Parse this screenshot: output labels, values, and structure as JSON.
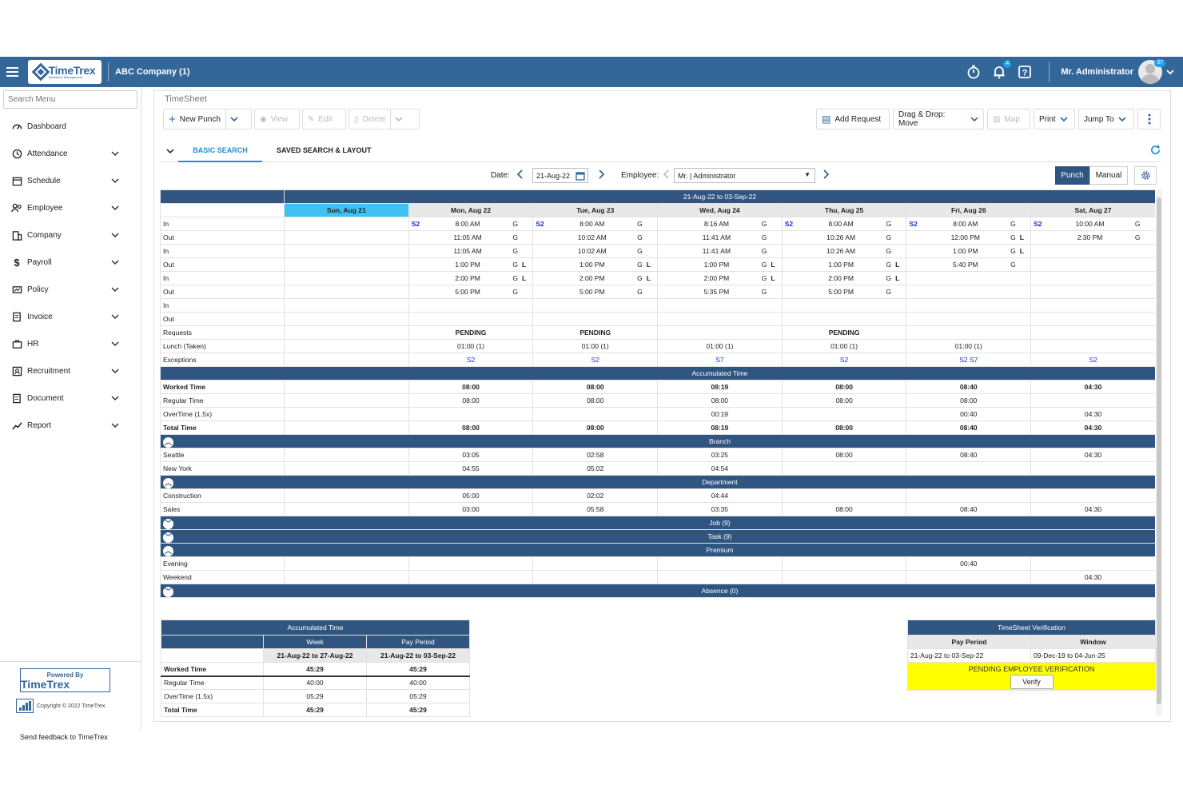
{
  "header": {
    "company": "ABC Company (1)",
    "user": "Mr. Administrator",
    "notifications_badge": "4",
    "avatar_badge": "37",
    "logo_text": "TimeTrex"
  },
  "sidebar": {
    "search_placeholder": "Search Menu",
    "items": [
      {
        "label": "Dashboard",
        "icon": "dashboard-icon"
      },
      {
        "label": "Attendance",
        "icon": "clock-icon"
      },
      {
        "label": "Schedule",
        "icon": "calendar-icon"
      },
      {
        "label": "Employee",
        "icon": "people-icon"
      },
      {
        "label": "Company",
        "icon": "building-icon"
      },
      {
        "label": "Payroll",
        "icon": "dollar-icon"
      },
      {
        "label": "Policy",
        "icon": "policy-icon"
      },
      {
        "label": "Invoice",
        "icon": "invoice-icon"
      },
      {
        "label": "HR",
        "icon": "briefcase-icon"
      },
      {
        "label": "Recruitment",
        "icon": "recruitment-icon"
      },
      {
        "label": "Document",
        "icon": "document-icon"
      },
      {
        "label": "Report",
        "icon": "chart-icon"
      }
    ],
    "powered_by": "Powered By",
    "powered_name": "TimeTrex",
    "copyright": "Copyright © 2022 TimeTrex.",
    "feedback": "Send feedback to TimeTrex"
  },
  "toolbar": {
    "title": "TimeSheet",
    "new_punch": "New Punch",
    "view": "View",
    "edit": "Edit",
    "delete": "Delete",
    "add_request": "Add Request",
    "drag_drop": "Drag & Drop: Move",
    "map": "Map",
    "print": "Print",
    "jump_to": "Jump To"
  },
  "tabs": {
    "basic": "BASIC SEARCH",
    "saved": "SAVED SEARCH & LAYOUT"
  },
  "filter": {
    "date_label": "Date:",
    "date_value": "21-Aug-22",
    "employee_label": "Employee:",
    "employee_value": "Mr. | Administrator",
    "punch": "Punch",
    "manual": "Manual"
  },
  "grid": {
    "range": "21-Aug-22 to 03-Sep-22",
    "days": [
      "Sun, Aug 21",
      "Mon, Aug 22",
      "Tue, Aug 23",
      "Wed, Aug 24",
      "Thu, Aug 25",
      "Fri, Aug 26",
      "Sat, Aug 27"
    ],
    "punch_rows": [
      {
        "label": "In",
        "cells": [
          null,
          {
            "s": "S2",
            "t": "8:00 AM",
            "g": "G",
            "l": ""
          },
          {
            "s": "S2",
            "t": "8:00 AM",
            "g": "G",
            "l": ""
          },
          {
            "s": "",
            "t": "8:16 AM",
            "g": "G",
            "l": ""
          },
          {
            "s": "S2",
            "t": "8:00 AM",
            "g": "G",
            "l": ""
          },
          {
            "s": "S2",
            "t": "8:00 AM",
            "g": "G",
            "l": ""
          },
          {
            "s": "S2",
            "t": "10:00 AM",
            "g": "G",
            "l": ""
          }
        ]
      },
      {
        "label": "Out",
        "cells": [
          null,
          {
            "s": "",
            "t": "11:05 AM",
            "g": "G",
            "l": ""
          },
          {
            "s": "",
            "t": "10:02 AM",
            "g": "G",
            "l": ""
          },
          {
            "s": "",
            "t": "11:41 AM",
            "g": "G",
            "l": ""
          },
          {
            "s": "",
            "t": "10:26 AM",
            "g": "G",
            "l": ""
          },
          {
            "s": "",
            "t": "12:00 PM",
            "g": "G",
            "l": "L"
          },
          {
            "s": "",
            "t": "2:30 PM",
            "g": "G",
            "l": ""
          }
        ]
      },
      {
        "label": "In",
        "cells": [
          null,
          {
            "s": "",
            "t": "11:05 AM",
            "g": "G",
            "l": ""
          },
          {
            "s": "",
            "t": "10:02 AM",
            "g": "G",
            "l": ""
          },
          {
            "s": "",
            "t": "11:41 AM",
            "g": "G",
            "l": ""
          },
          {
            "s": "",
            "t": "10:26 AM",
            "g": "G",
            "l": ""
          },
          {
            "s": "",
            "t": "1:00 PM",
            "g": "G",
            "l": "L"
          },
          null
        ]
      },
      {
        "label": "Out",
        "cells": [
          null,
          {
            "s": "",
            "t": "1:00 PM",
            "g": "G",
            "l": "L"
          },
          {
            "s": "",
            "t": "1:00 PM",
            "g": "G",
            "l": "L"
          },
          {
            "s": "",
            "t": "1:00 PM",
            "g": "G",
            "l": "L"
          },
          {
            "s": "",
            "t": "1:00 PM",
            "g": "G",
            "l": "L"
          },
          {
            "s": "",
            "t": "5:40 PM",
            "g": "G",
            "l": ""
          },
          null
        ]
      },
      {
        "label": "In",
        "cells": [
          null,
          {
            "s": "",
            "t": "2:00 PM",
            "g": "G",
            "l": "L"
          },
          {
            "s": "",
            "t": "2:00 PM",
            "g": "G",
            "l": "L"
          },
          {
            "s": "",
            "t": "2:00 PM",
            "g": "G",
            "l": "L"
          },
          {
            "s": "",
            "t": "2:00 PM",
            "g": "G",
            "l": "L"
          },
          null,
          null
        ]
      },
      {
        "label": "Out",
        "cells": [
          null,
          {
            "s": "",
            "t": "5:00 PM",
            "g": "G",
            "l": ""
          },
          {
            "s": "",
            "t": "5:00 PM",
            "g": "G",
            "l": ""
          },
          {
            "s": "",
            "t": "5:35 PM",
            "g": "G",
            "l": ""
          },
          {
            "s": "",
            "t": "5:00 PM",
            "g": "G",
            "l": ""
          },
          null,
          null
        ]
      },
      {
        "label": "In",
        "cells": [
          null,
          null,
          null,
          null,
          null,
          null,
          null
        ]
      },
      {
        "label": "Out",
        "cells": [
          null,
          null,
          null,
          null,
          null,
          null,
          null
        ]
      }
    ],
    "requests": {
      "label": "Requests",
      "values": [
        "",
        "PENDING",
        "PENDING",
        "",
        "PENDING",
        "",
        ""
      ]
    },
    "lunch": {
      "label": "Lunch (Taken)",
      "values": [
        "",
        "01:00 (1)",
        "01:00 (1)",
        "01:00 (1)",
        "01:00 (1)",
        "01:00 (1)",
        ""
      ]
    },
    "exceptions": {
      "label": "Exceptions",
      "values": [
        "",
        "S2",
        "S2",
        "S7",
        "S2",
        "S2  S7",
        "S2"
      ]
    },
    "accumulated": {
      "title": "Accumulated Time",
      "rows": [
        {
          "label": "Worked Time",
          "values": [
            "",
            "08:00",
            "08:00",
            "08:19",
            "08:00",
            "08:40",
            "04:30"
          ],
          "bold": true,
          "wt": true
        },
        {
          "label": "Regular Time",
          "values": [
            "",
            "08:00",
            "08:00",
            "08:00",
            "08:00",
            "08:00",
            ""
          ]
        },
        {
          "label": "OverTime (1.5x)",
          "values": [
            "",
            "",
            "",
            "00:19",
            "",
            "00:40",
            "04:30"
          ]
        },
        {
          "label": "Total Time",
          "values": [
            "",
            "08:00",
            "08:00",
            "08:19",
            "08:00",
            "08:40",
            "04:30"
          ],
          "bold": true
        }
      ]
    },
    "branch": {
      "title": "Branch",
      "rows": [
        {
          "label": "Seattle",
          "values": [
            "",
            "03:05",
            "02:58",
            "03:25",
            "08:00",
            "08:40",
            "04:30"
          ]
        },
        {
          "label": "New York",
          "values": [
            "",
            "04:55",
            "05:02",
            "04:54",
            "",
            "",
            ""
          ]
        }
      ]
    },
    "department": {
      "title": "Department",
      "rows": [
        {
          "label": "Construction",
          "values": [
            "",
            "05:00",
            "02:02",
            "04:44",
            "",
            "",
            ""
          ]
        },
        {
          "label": "Sales",
          "values": [
            "",
            "03:00",
            "05:58",
            "03:35",
            "08:00",
            "08:40",
            "04:30"
          ]
        }
      ]
    },
    "job": {
      "title": "Job (9)"
    },
    "task": {
      "title": "Task (9)"
    },
    "premium": {
      "title": "Premium",
      "rows": [
        {
          "label": "Evening",
          "values": [
            "",
            "",
            "",
            "",
            "",
            "00:40",
            ""
          ]
        },
        {
          "label": "Weekend",
          "values": [
            "",
            "",
            "",
            "",
            "",
            "",
            "04:30"
          ]
        }
      ]
    },
    "absence": {
      "title": "Absence (0)"
    }
  },
  "summary": {
    "title": "Accumulated Time",
    "col_week": "Week",
    "col_period": "Pay Period",
    "week_range": "21-Aug-22 to 27-Aug-22",
    "period_range": "21-Aug-22 to 03-Sep-22",
    "rows": [
      {
        "label": "Worked Time",
        "week": "45:29",
        "period": "45:29"
      },
      {
        "label": "Regular Time",
        "week": "40:00",
        "period": "40:00"
      },
      {
        "label": "OverTime (1.5x)",
        "week": "05:29",
        "period": "05:29"
      },
      {
        "label": "Total Time",
        "week": "45:29",
        "period": "45:29"
      }
    ]
  },
  "verification": {
    "title": "TimeSheet Verification",
    "col_period": "Pay Period",
    "col_window": "Window",
    "period": "21-Aug-22 to 03-Sep-22",
    "window": "09-Dec-19 to 04-Jun-25",
    "status": "PENDING EMPLOYEE VERIFICATION",
    "verify": "Verify",
    "status_color": "#ffff00"
  }
}
